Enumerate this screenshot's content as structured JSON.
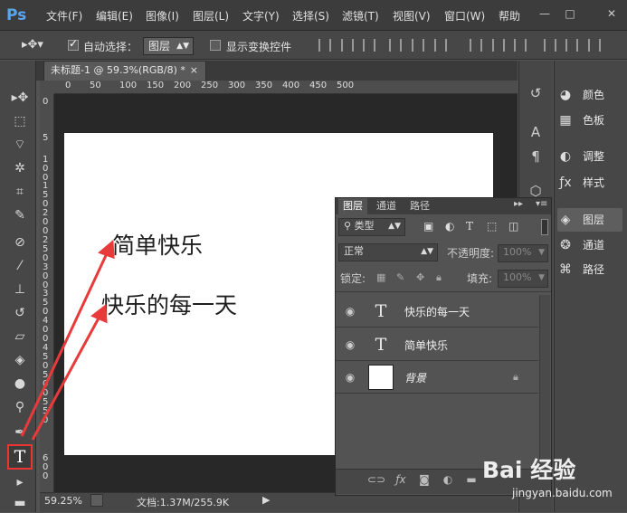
{
  "menubar": {
    "logo": "Ps",
    "items": [
      "文件(F)",
      "编辑(E)",
      "图像(I)",
      "图层(L)",
      "文字(Y)",
      "选择(S)",
      "滤镜(T)",
      "视图(V)",
      "窗口(W)",
      "帮助"
    ],
    "window_buttons": [
      "—",
      "□",
      "✕"
    ]
  },
  "options": {
    "auto_select_label": "自动选择：",
    "auto_select_value": "图层",
    "show_transform_label": "显示变换控件"
  },
  "document": {
    "tab_title": "未标题-1 @ 59.3%(RGB/8) *",
    "tab_close": "×",
    "texts": [
      "简单快乐",
      "快乐的每一天"
    ]
  },
  "rulers": {
    "top": [
      "0",
      "50",
      "100",
      "150",
      "200",
      "250",
      "300",
      "350",
      "400",
      "450",
      "500"
    ],
    "left": [
      "0",
      "5",
      "1\n0\n0",
      "1\n5\n0",
      "2\n0\n0",
      "2\n5\n0",
      "3\n0\n0",
      "3\n5\n0",
      "4\n0\n0",
      "4\n5\n0",
      "5\n0\n0",
      "5\n5\n0",
      "6\n0\n0"
    ]
  },
  "status": {
    "zoom": "59.25%",
    "doc_info": "文档:1.37M/255.9K"
  },
  "right_panel": {
    "items": [
      {
        "label": "颜色",
        "icon": "color-palette-icon"
      },
      {
        "label": "色板",
        "icon": "swatches-icon"
      },
      {
        "label": "调整",
        "icon": "adjustments-icon"
      },
      {
        "label": "样式",
        "icon": "styles-icon"
      },
      {
        "label": "图层",
        "icon": "layers-icon"
      },
      {
        "label": "通道",
        "icon": "channels-icon"
      },
      {
        "label": "路径",
        "icon": "paths-icon"
      }
    ]
  },
  "layers_panel": {
    "tabs": [
      "图层",
      "通道",
      "路径"
    ],
    "filter_label": "类型",
    "blend_mode": "正常",
    "opacity_label": "不透明度:",
    "opacity_value": "100%",
    "lock_label": "锁定:",
    "fill_label": "填充:",
    "fill_value": "100%",
    "layers": [
      {
        "name": "快乐的每一天",
        "type": "text"
      },
      {
        "name": "简单快乐",
        "type": "text"
      },
      {
        "name": "背景",
        "type": "background"
      }
    ]
  },
  "watermark": {
    "logo": "Bai 经验",
    "url": "jingyan.baidu.com"
  },
  "colors": {
    "annotation_red": "#e83a3a",
    "canvas": "#ffffff",
    "workarea": "#282828"
  }
}
